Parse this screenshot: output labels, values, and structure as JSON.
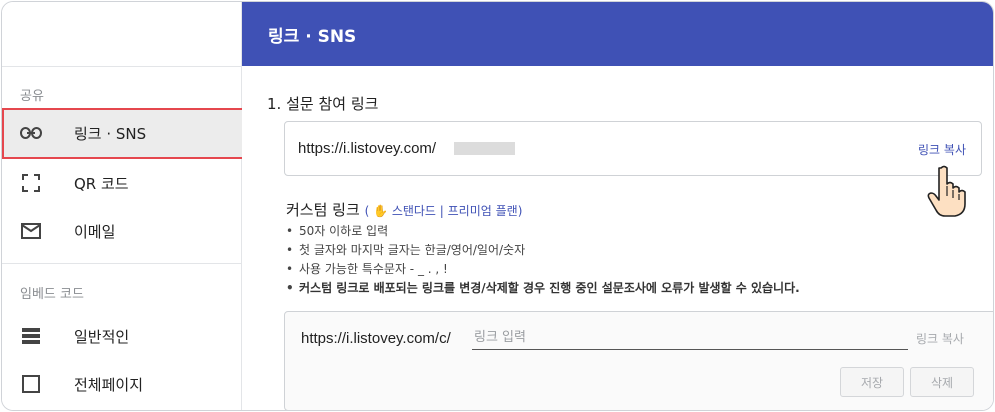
{
  "header": {
    "title": "링크 · SNS"
  },
  "sidebar": {
    "share_label": "공유",
    "share_items": [
      {
        "label": "링크 · SNS",
        "icon": "link-icon",
        "active": true
      },
      {
        "label": "QR 코드",
        "icon": "qr-frame-icon",
        "active": false
      },
      {
        "label": "이메일",
        "icon": "mail-icon",
        "active": false
      }
    ],
    "embed_label": "임베드 코드",
    "embed_items": [
      {
        "label": "일반적인",
        "icon": "list-icon"
      },
      {
        "label": "전체페이지",
        "icon": "square-icon"
      }
    ]
  },
  "main": {
    "section_title": "1. 설문 참여 링크",
    "link_url": "https://i.listovey.com/",
    "link_copy": "링크 복사",
    "custom_title": "커스텀 링크",
    "custom_plan": "( ✋ 스탠다드 | 프리미엄 플랜)",
    "rules": [
      "50자 이하로 입력",
      "첫 글자와 마지막 글자는 한글/영어/일어/숫자",
      "사용 가능한 특수문자 - _ . , !",
      "커스텀 링크로 배포되는 링크를 변경/삭제할 경우 진행 중인 설문조사에 오류가 발생할 수 있습니다."
    ],
    "custom_prefix": "https://i.listovey.com/c/",
    "custom_placeholder": "링크 입력",
    "custom_copy": "링크 복사",
    "save_label": "저장",
    "delete_label": "삭제"
  },
  "colors": {
    "header_bg": "#3f51b5",
    "accent": "#3f51b5",
    "active_border": "#e5474e"
  }
}
